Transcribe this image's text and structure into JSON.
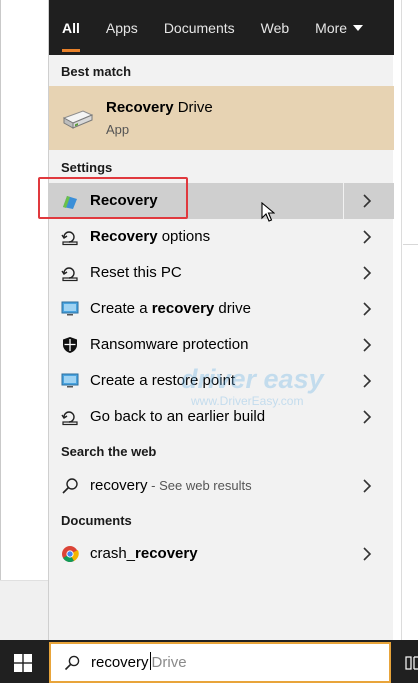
{
  "tabs": [
    {
      "label": "All",
      "active": true
    },
    {
      "label": "Apps"
    },
    {
      "label": "Documents"
    },
    {
      "label": "Web"
    },
    {
      "label": "More"
    }
  ],
  "best_match": {
    "section": "Best match",
    "title_bold": "Recovery",
    "title_rest": " Drive",
    "subtitle": "App",
    "icon": "drive-icon"
  },
  "settings": {
    "section": "Settings",
    "items": [
      {
        "bold": "Recovery",
        "rest": "",
        "icon": "recovery-flag-icon"
      },
      {
        "bold": "Recovery",
        "rest": " options",
        "icon": "reset-pc-icon"
      },
      {
        "pre": "Reset this PC",
        "icon": "reset-pc-icon"
      },
      {
        "pre": "Create a ",
        "bold": "recovery",
        "rest": " drive",
        "icon": "monitor-icon"
      },
      {
        "pre": "Ransomware protection",
        "icon": "shield-icon"
      },
      {
        "pre": "Create a restore point",
        "icon": "monitor-icon"
      },
      {
        "pre": "Go back to an earlier build",
        "icon": "reset-pc-icon"
      }
    ]
  },
  "web": {
    "section": "Search the web",
    "query": "recovery",
    "suffix": " - See web results"
  },
  "documents": {
    "section": "Documents",
    "item_pre": "crash_",
    "item_bold": "recovery",
    "icon": "chrome-icon"
  },
  "watermark": {
    "title": "driver easy",
    "url": "www.DriverEasy.com"
  },
  "search": {
    "typed": "recovery",
    "suggestion": "Drive"
  },
  "colors": {
    "taskbar": "#202020",
    "tabs_bg": "#1f1f1f",
    "accent": "#e8812a",
    "best_match_bg": "#e7d3b3",
    "highlight_border": "#e0393e"
  }
}
